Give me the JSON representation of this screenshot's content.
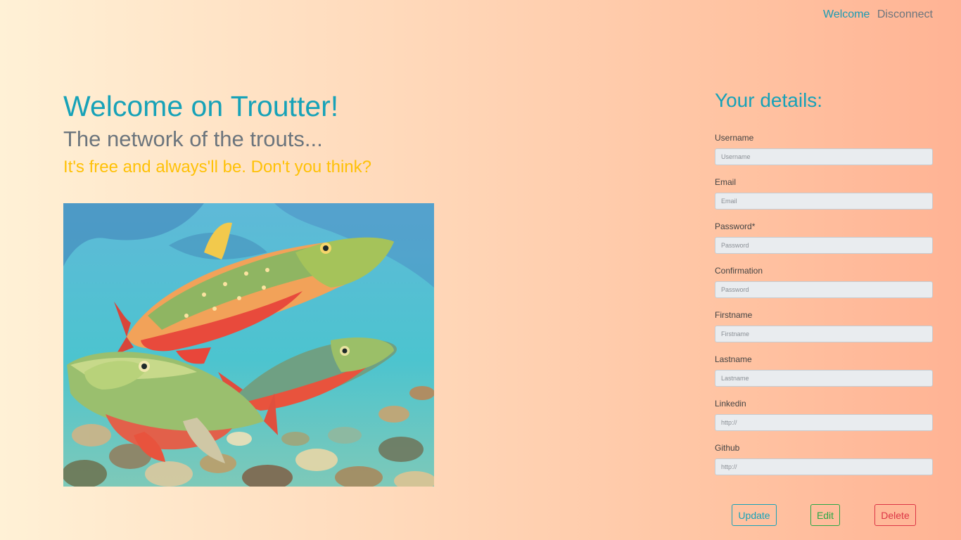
{
  "nav": {
    "welcome": "Welcome",
    "disconnect": "Disconnect"
  },
  "hero": {
    "title": "Welcome on Troutter!",
    "subtitle": "The network of the trouts...",
    "tagline": "It's free and always'll be. Don't you think?"
  },
  "form": {
    "heading": "Your details:",
    "fields": [
      {
        "label": "Username",
        "placeholder": "Username"
      },
      {
        "label": "Email",
        "placeholder": "Email"
      },
      {
        "label": "Password*",
        "placeholder": "Password"
      },
      {
        "label": "Confirmation",
        "placeholder": "Password"
      },
      {
        "label": "Firstname",
        "placeholder": "Firstname"
      },
      {
        "label": "Lastname",
        "placeholder": "Lastname"
      },
      {
        "label": "Linkedin",
        "placeholder": "http://"
      },
      {
        "label": "Github",
        "placeholder": "http://"
      }
    ],
    "buttons": {
      "update": "Update",
      "edit": "Edit",
      "delete": "Delete"
    }
  },
  "colors": {
    "accent": "#17a2b8",
    "muted": "#6c757d",
    "warning": "#ffc107",
    "success": "#28a745",
    "danger": "#dc3545"
  }
}
